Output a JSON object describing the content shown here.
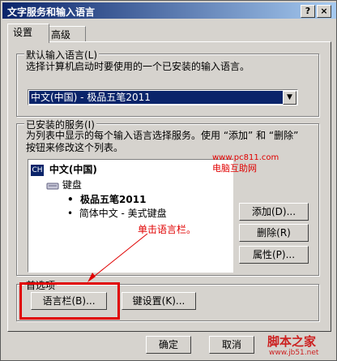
{
  "window": {
    "title": "文字服务和输入语言",
    "help_btn": "?",
    "close_btn": "×"
  },
  "tabs": [
    {
      "label": "设置"
    },
    {
      "label": "高级"
    }
  ],
  "default_lang": {
    "legend": "默认输入语言(L)",
    "description": "选择计算机启动时要使用的一个已安装的输入语言。",
    "value": "中文(中国) - 极品五笔2011"
  },
  "installed": {
    "legend": "已安装的服务(I)",
    "description": "为列表中显示的每个输入语言选择服务。使用 “添加” 和 “删除” 按钮来修改这个列表。",
    "tree": {
      "badge": "CH",
      "language": "中文(中国)",
      "category": "键盘",
      "items": [
        "极品五笔2011",
        "简体中文 - 美式键盘"
      ]
    },
    "buttons": {
      "add": "添加(D)...",
      "remove": "删除(R)",
      "properties": "属性(P)..."
    }
  },
  "preferences": {
    "legend": "首选项",
    "langbar_btn": "语言栏(B)...",
    "keys_btn": "键设置(K)..."
  },
  "annotations": {
    "site_url": "www.pc811.com",
    "site_name": "电脑互助网",
    "click_hint": "单击语言栏。"
  },
  "footer": {
    "ok": "确定",
    "cancel": "取消"
  },
  "watermark": {
    "title": "脚本之家",
    "url": "www.jb51.net"
  },
  "colors": {
    "title_gradient_start": "#0a246a",
    "title_gradient_end": "#a6caf0",
    "annotation": "#e00000"
  }
}
